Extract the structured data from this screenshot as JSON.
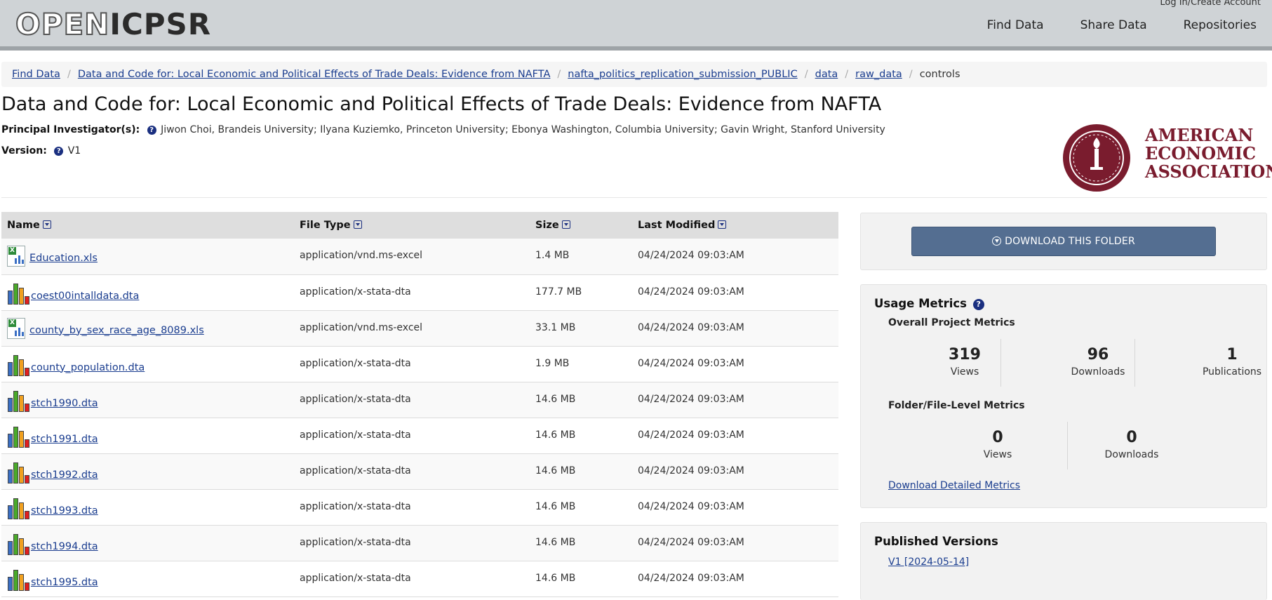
{
  "header": {
    "logo_open": "OPEN",
    "logo_icpsr": "ICPSR",
    "login": "Log In/Create Account",
    "nav": [
      "Find Data",
      "Share Data",
      "Repositories"
    ]
  },
  "breadcrumb": {
    "links": [
      "Find Data",
      "Data and Code for: Local Economic and Political Effects of Trade Deals: Evidence from NAFTA",
      "nafta_politics_replication_submission_PUBLIC",
      "data",
      "raw_data"
    ],
    "current": "controls"
  },
  "project": {
    "title": "Data and Code for: Local Economic and Political Effects of Trade Deals: Evidence from NAFTA",
    "pi_label": "Principal Investigator(s)",
    "pi_names": "Jiwon Choi, Brandeis University; Ilyana Kuziemko, Princeton University; Ebonya Washington, Columbia University; Gavin Wright, Stanford University",
    "version_label": "Version",
    "version_value": "V1"
  },
  "publisher_logo": {
    "line1": "AMERICAN",
    "line2": "ECONOMIC",
    "line3": "ASSOCIATION",
    "color": "#7a1c2e"
  },
  "table": {
    "columns": [
      "Name",
      "File Type",
      "Size",
      "Last Modified"
    ],
    "rows": [
      {
        "name": "Education.xls",
        "type": "application/vnd.ms-excel",
        "size": "1.4 MB",
        "modified": "04/24/2024 09:03:AM",
        "icon": "excel-file-icon"
      },
      {
        "name": "coest00intalldata.dta",
        "type": "application/x-stata-dta",
        "size": "177.7 MB",
        "modified": "04/24/2024 09:03:AM",
        "icon": "stata-file-icon"
      },
      {
        "name": "county_by_sex_race_age_8089.xls",
        "type": "application/vnd.ms-excel",
        "size": "33.1 MB",
        "modified": "04/24/2024 09:03:AM",
        "icon": "excel-file-icon"
      },
      {
        "name": "county_population.dta",
        "type": "application/x-stata-dta",
        "size": "1.9 MB",
        "modified": "04/24/2024 09:03:AM",
        "icon": "stata-file-icon"
      },
      {
        "name": "stch1990.dta",
        "type": "application/x-stata-dta",
        "size": "14.6 MB",
        "modified": "04/24/2024 09:03:AM",
        "icon": "stata-file-icon"
      },
      {
        "name": "stch1991.dta",
        "type": "application/x-stata-dta",
        "size": "14.6 MB",
        "modified": "04/24/2024 09:03:AM",
        "icon": "stata-file-icon"
      },
      {
        "name": "stch1992.dta",
        "type": "application/x-stata-dta",
        "size": "14.6 MB",
        "modified": "04/24/2024 09:03:AM",
        "icon": "stata-file-icon"
      },
      {
        "name": "stch1993.dta",
        "type": "application/x-stata-dta",
        "size": "14.6 MB",
        "modified": "04/24/2024 09:03:AM",
        "icon": "stata-file-icon"
      },
      {
        "name": "stch1994.dta",
        "type": "application/x-stata-dta",
        "size": "14.6 MB",
        "modified": "04/24/2024 09:03:AM",
        "icon": "stata-file-icon"
      },
      {
        "name": "stch1995.dta",
        "type": "application/x-stata-dta",
        "size": "14.6 MB",
        "modified": "04/24/2024 09:03:AM",
        "icon": "stata-file-icon"
      }
    ]
  },
  "download": {
    "label": "DOWNLOAD THIS FOLDER"
  },
  "metrics": {
    "heading": "Usage Metrics",
    "overall_heading": "Overall Project Metrics",
    "overall": [
      {
        "value": "319",
        "label": "Views"
      },
      {
        "value": "96",
        "label": "Downloads"
      },
      {
        "value": "1",
        "label": "Publications"
      }
    ],
    "folder_heading": "Folder/File-Level Metrics",
    "folder": [
      {
        "value": "0",
        "label": "Views"
      },
      {
        "value": "0",
        "label": "Downloads"
      }
    ],
    "detail_link": "Download Detailed Metrics"
  },
  "versions": {
    "heading": "Published Versions",
    "items": [
      "V1 [2024-05-14]"
    ]
  }
}
